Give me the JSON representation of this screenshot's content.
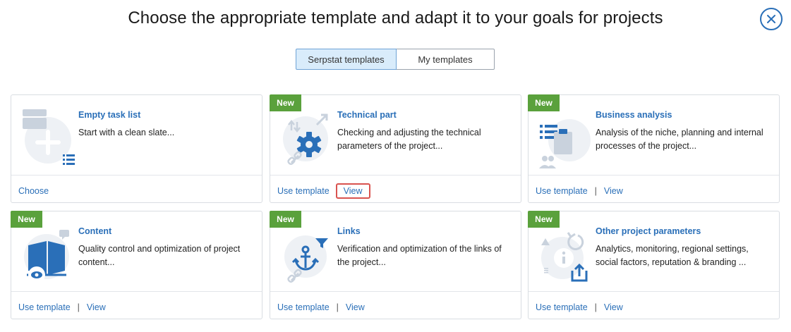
{
  "header": {
    "title": "Choose the appropriate template and adapt it to your goals for projects"
  },
  "tabs": [
    {
      "label": "Serpstat templates",
      "active": true
    },
    {
      "label": "My templates",
      "active": false
    }
  ],
  "colors": {
    "accent": "#2a6fb8",
    "badge": "#5aa13c",
    "highlight": "#d9534f",
    "active_tab": "#d9ecfb"
  },
  "cards": [
    {
      "title": "Empty task list",
      "description": "Start with a clean slate...",
      "badge": "",
      "actions": [
        "Choose"
      ],
      "icon": "folder-plus-list-icon"
    },
    {
      "title": "Technical part",
      "description": "Checking and adjusting the technical parameters of the project...",
      "badge": "New",
      "actions": [
        "Use template",
        "View"
      ],
      "icon": "gear-link-icon"
    },
    {
      "title": "Business analysis",
      "description": "Analysis of the niche, planning and internal processes of the project...",
      "badge": "New",
      "actions": [
        "Use template",
        "View"
      ],
      "icon": "clipboard-list-icon"
    },
    {
      "title": "Content",
      "description": "Quality control and optimization of project content...",
      "badge": "New",
      "actions": [
        "Use template",
        "View"
      ],
      "icon": "book-eye-icon"
    },
    {
      "title": "Links",
      "description": "Verification and optimization of the links of the project...",
      "badge": "New",
      "actions": [
        "Use template",
        "View"
      ],
      "icon": "anchor-link-icon"
    },
    {
      "title": "Other project parameters",
      "description": "Analytics, monitoring, regional settings, social factors, reputation & branding ...",
      "badge": "New",
      "actions": [
        "Use template",
        "View"
      ],
      "icon": "info-upload-icon"
    }
  ]
}
